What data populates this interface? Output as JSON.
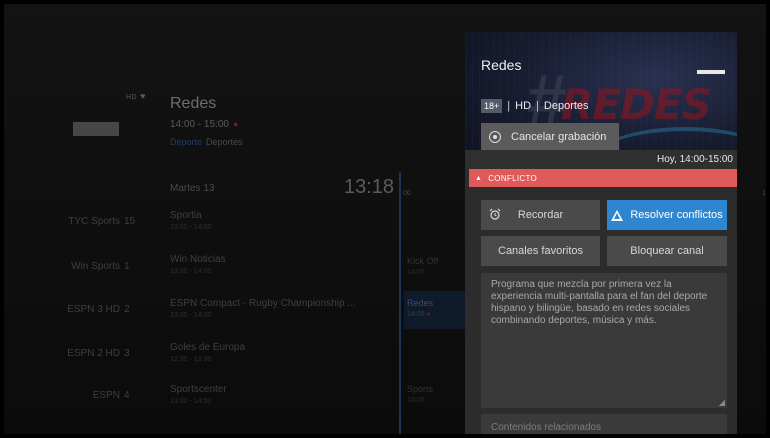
{
  "header": {
    "hd_badge": "HD",
    "program_title": "Redes",
    "program_time": "14:00 - 15:00",
    "genre_primary": "Deporte",
    "genre_secondary": "Deportes"
  },
  "guide": {
    "date_label": "Martes 13",
    "clock": "13:18",
    "clock_sub": "00",
    "clock_right": "13",
    "channels": [
      {
        "name": "TYC Sports",
        "number": "15"
      },
      {
        "name": "Win Sports",
        "number": "1"
      },
      {
        "name": "ESPN 3 HD",
        "number": "2"
      },
      {
        "name": "ESPN 2 HD",
        "number": "3"
      },
      {
        "name": "ESPN",
        "number": "4"
      }
    ],
    "listings": [
      {
        "title": "Sportia",
        "time": "13:00 - 14:00"
      },
      {
        "title": "Win Noticias",
        "time": "13:00 - 14:00"
      },
      {
        "title": "ESPN Compact - Rugby Championship ...",
        "time": "13:00 - 14:00"
      },
      {
        "title": "Goles de Europa",
        "time": "12:30 - 13:30"
      },
      {
        "title": "Sportscenter",
        "time": "13:00 - 14:00"
      }
    ],
    "next_listings": [
      {
        "title": "Kick Off",
        "time": "14:00"
      },
      {
        "title": "",
        "time": ""
      },
      {
        "title": "Redes",
        "time": "14:00"
      },
      {
        "title": "",
        "time": ""
      },
      {
        "title": "Sports",
        "time": "14:00"
      }
    ]
  },
  "panel": {
    "title": "Redes",
    "age_rating": "18+",
    "quality": "HD",
    "category": "Deportes",
    "cancel_recording_label": "Cancelar grabación",
    "date_time": "Hoy, 14:00-15:00",
    "conflict_label": "CONFLICTO",
    "remind_label": "Recordar",
    "resolve_label": "Resolver conflictos",
    "favorites_label": "Canales favoritos",
    "block_label": "Bloquear canal",
    "description": "Programa que mezcla por primera vez la experiencia multi-pantalla para el fan del deporte hispano y bilingüe, basado en redes sociales combinando deportes, música y más.",
    "related_label": "Contenidos relacionados",
    "colors": {
      "accent": "#2f86d0",
      "conflict": "#e05a5a"
    }
  }
}
